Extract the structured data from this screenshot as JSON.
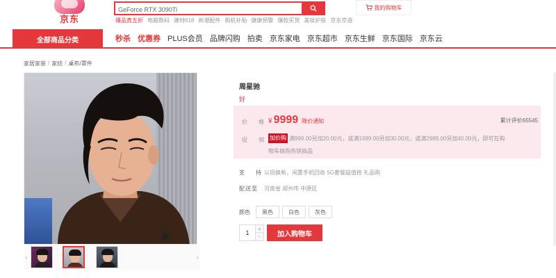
{
  "logo": {
    "text": "京东",
    "icon": "jd-logo-icon"
  },
  "search": {
    "value": "GeForce RTX 3090Ti",
    "button_icon": "search-icon"
  },
  "hotwords": [
    "爆品真五折",
    "电脑数码",
    "建材618",
    "新潮配件",
    "购机补贴",
    "健康预警",
    "爆款买货",
    "美妆护肤",
    "京东京造"
  ],
  "cart": {
    "label": "我的购物车",
    "icon": "cart-icon"
  },
  "nav": {
    "all_categories": "全部商品分类",
    "items": [
      "秒杀",
      "优惠券",
      "PLUS会员",
      "品牌闪购",
      "拍卖",
      "京东家电",
      "京东超市",
      "京东生鲜",
      "京东国际",
      "京东云"
    ]
  },
  "breadcrumb": [
    "家居家装",
    "家纺",
    "桌布/罩件"
  ],
  "product": {
    "title": "周星驰",
    "subtitle": "好",
    "price_label": "价　格",
    "currency": "¥",
    "price": "9999",
    "price_note": "降价通知",
    "reviews": "累计评价65545",
    "promo_label": "促　销",
    "promo_badge": "加价购",
    "promo_text": "满999.00另加20.00元，或满1999.00另加30.00元，或满2999.00另加40.00元，即可在购",
    "promo_sub": "物车换购热销商品",
    "support_label": "支　持",
    "support_value": "以旧换新，闲置手机回收 5G套餐超值抢 礼品购",
    "delivery_label": "配送至",
    "delivery_value": "河南省 郑州市 中原区",
    "color_label": "颜色",
    "colors": [
      "黑色",
      "白色",
      "灰色"
    ],
    "quantity": "1",
    "add_to_cart": "加入购物车"
  },
  "colors": {
    "accent": "#e4393c",
    "promo_bg": "#fbe9ee"
  }
}
